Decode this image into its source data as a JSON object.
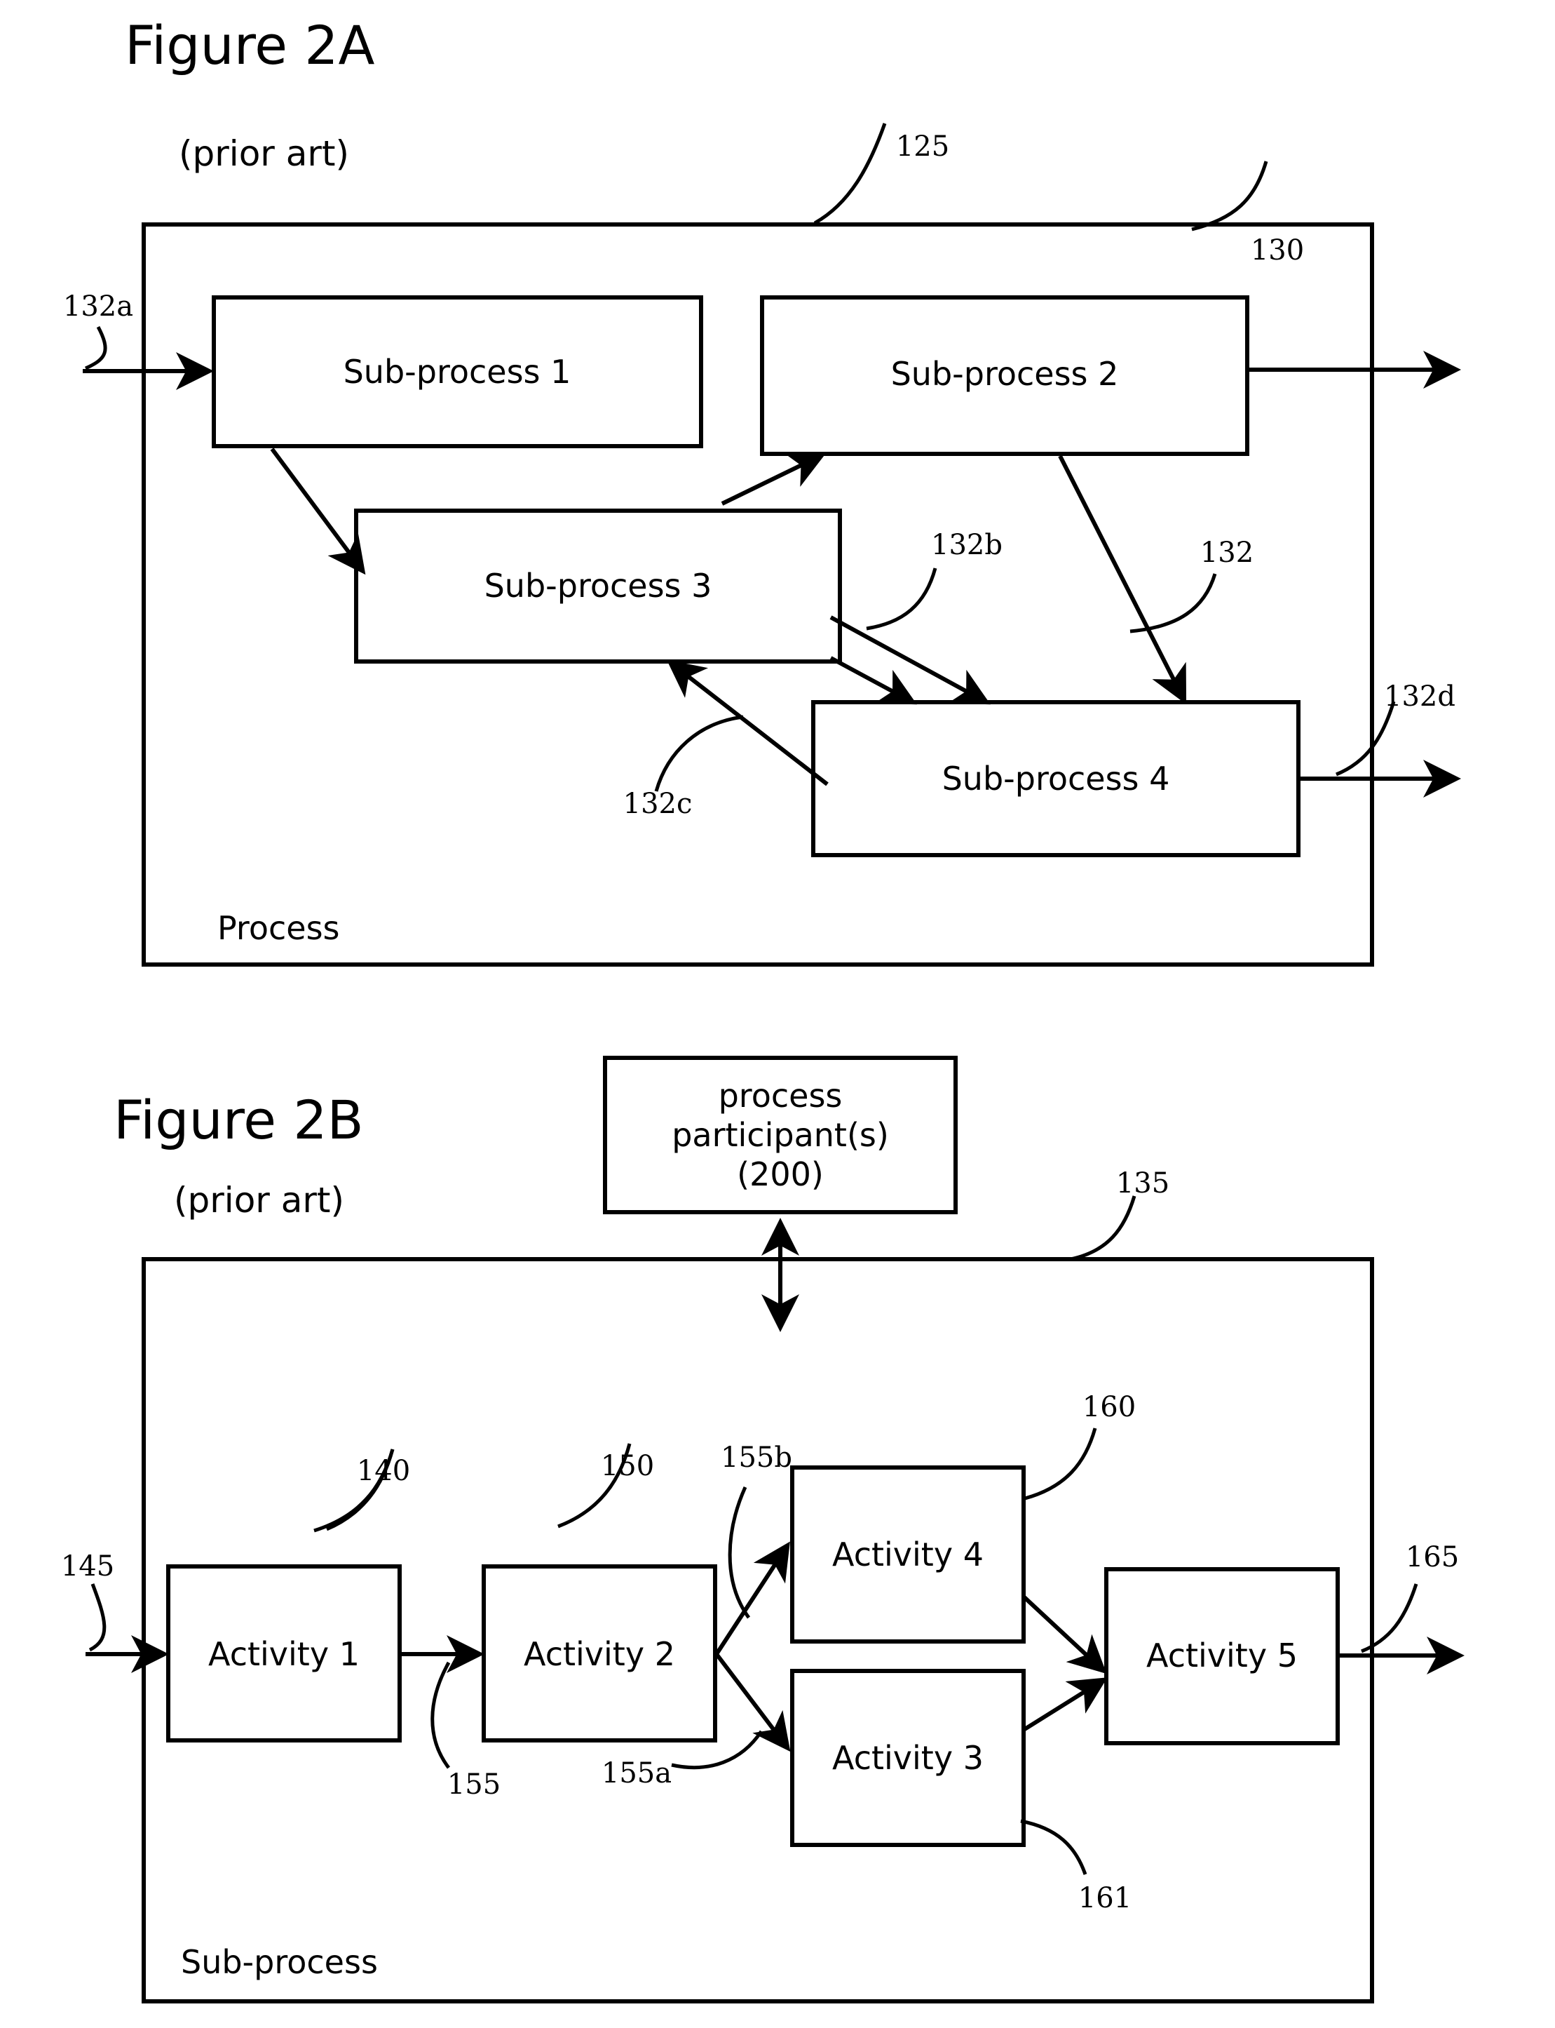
{
  "figures": [
    {
      "id": "figure-2a",
      "title": "Figure 2A",
      "subtitle": "(prior art)",
      "container_label": "Process",
      "container_ref": "125",
      "boxes": [
        {
          "key": "sp1",
          "label": "Sub-process 1"
        },
        {
          "key": "sp2",
          "label": "Sub-process 2"
        },
        {
          "key": "sp3",
          "label": "Sub-process 3"
        },
        {
          "key": "sp4",
          "label": "Sub-process 4"
        }
      ],
      "refs": [
        {
          "key": "r125",
          "text": "125"
        },
        {
          "key": "r130",
          "text": "130"
        },
        {
          "key": "r132a",
          "text": "132a"
        },
        {
          "key": "r132b",
          "text": "132b"
        },
        {
          "key": "r132",
          "text": "132"
        },
        {
          "key": "r132c",
          "text": "132c"
        },
        {
          "key": "r132d",
          "text": "132d"
        }
      ]
    },
    {
      "id": "figure-2b",
      "title": "Figure 2B",
      "subtitle": "(prior art)",
      "container_label": "Sub-process",
      "container_ref": "135",
      "participant_box": {
        "line1": "process",
        "line2": "participant(s)",
        "line3": "(200)"
      },
      "boxes": [
        {
          "key": "a1",
          "label": "Activity 1"
        },
        {
          "key": "a2",
          "label": "Activity 2"
        },
        {
          "key": "a3",
          "label": "Activity 3"
        },
        {
          "key": "a4",
          "label": "Activity 4"
        },
        {
          "key": "a5",
          "label": "Activity 5"
        }
      ],
      "refs": [
        {
          "key": "r135",
          "text": "135"
        },
        {
          "key": "r140",
          "text": "140"
        },
        {
          "key": "r145",
          "text": "145"
        },
        {
          "key": "r150",
          "text": "150"
        },
        {
          "key": "r155",
          "text": "155"
        },
        {
          "key": "r155a",
          "text": "155a"
        },
        {
          "key": "r155b",
          "text": "155b"
        },
        {
          "key": "r160",
          "text": "160"
        },
        {
          "key": "r161",
          "text": "161"
        },
        {
          "key": "r165",
          "text": "165"
        }
      ]
    }
  ],
  "colors": {
    "ink": "#000000",
    "paper": "#ffffff"
  }
}
